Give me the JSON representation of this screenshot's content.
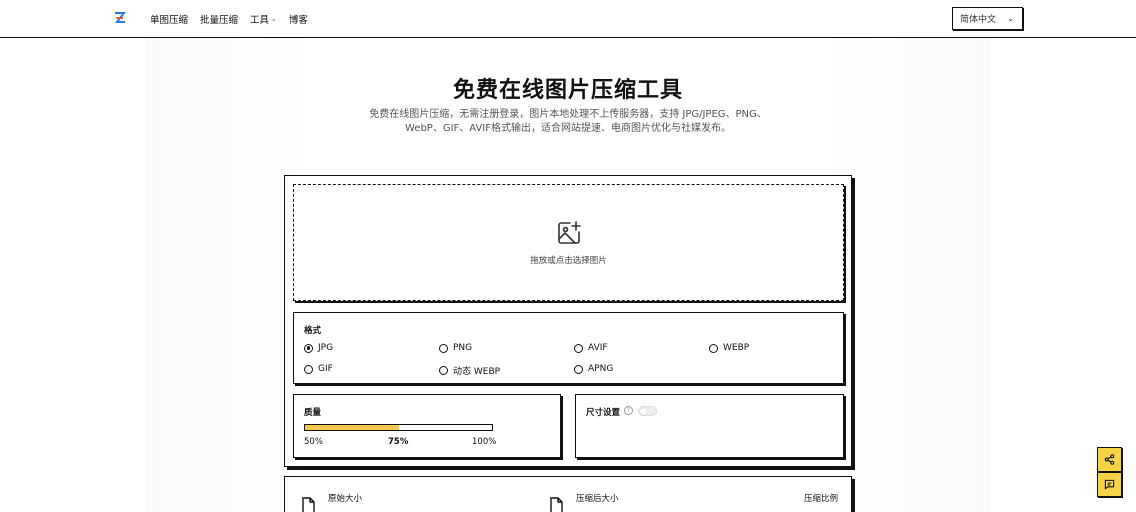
{
  "header": {
    "nav": [
      "单图压缩",
      "批量压缩",
      "工具",
      "博客"
    ],
    "language": "简体中文"
  },
  "hero": {
    "title": "免费在线图片压缩工具",
    "subtitle": "免费在线图片压缩，无需注册登录，图片本地处理不上传服务器，支持 JPG/JPEG、PNG、WebP、GIF、AVIF格式输出，适合网站提速、电商图片优化与社媒发布。"
  },
  "dropzone": {
    "hint": "拖放或点击选择图片"
  },
  "format": {
    "label": "格式",
    "options": [
      "JPG",
      "PNG",
      "AVIF",
      "WEBP",
      "GIF",
      "动态 WEBP",
      "APNG"
    ],
    "selected": "JPG"
  },
  "quality": {
    "label": "质量",
    "min_label": "50%",
    "current_label": "75%",
    "max_label": "100%",
    "value": 75,
    "min": 50,
    "max": 100
  },
  "size": {
    "label": "尺寸设置",
    "enabled": false
  },
  "result": {
    "original_label": "原始大小",
    "compressed_label": "压缩后大小",
    "ratio_label": "压缩比例"
  },
  "colors": {
    "accent": "#f2c94c",
    "float_bg": "#f5d547",
    "border": "#111111"
  }
}
